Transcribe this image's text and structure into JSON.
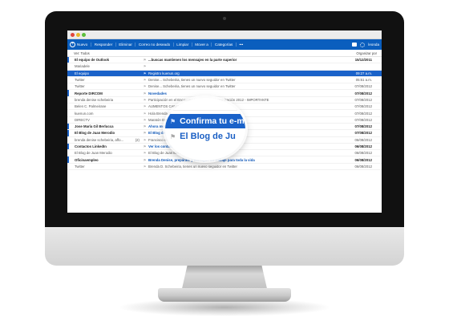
{
  "commandbar": {
    "new_label": "Nuevo",
    "items": [
      "Responder",
      "Eliminar",
      "Correo no deseado",
      "Limpiar",
      "Mover a",
      "Categorías",
      "•••"
    ],
    "user_label": "leonda"
  },
  "filterbar": {
    "view_label": "Ver: Todos",
    "arrange_label": "Organizar por"
  },
  "emails": [
    {
      "from": "El equipo de Outlook",
      "subject": "...buscas mantienen los mensajes en la parte superior",
      "date": "15/12/2011",
      "unread": true,
      "selected": false,
      "subject_link": false
    },
    {
      "from": "Mariadele",
      "subject": "",
      "date": "",
      "unread": false,
      "selected": false,
      "subject_link": false
    },
    {
      "from": "El equipo",
      "subject": "Registro kuenun.org",
      "date": "09:27 a.m.",
      "unread": false,
      "selected": true,
      "subject_link": false
    },
    {
      "from": "Twitter",
      "subject": "Denise... Schebeiria, tienes un nuevo seguidor en Twitter",
      "date": "05:51 a.m.",
      "unread": false,
      "selected": false,
      "subject_link": false
    },
    {
      "from": "Twitter",
      "subject": "Denise... Schebeiria, tienes un nuevo seguidor en Twitter",
      "date": "07/08/2012",
      "unread": false,
      "selected": false,
      "subject_link": false
    },
    {
      "from": "Reporte DIRCOM",
      "subject": "Novedades",
      "date": "07/08/2012",
      "unread": true,
      "selected": false,
      "subject_link": true
    },
    {
      "from": "brenda denise schebeiria",
      "subject": "Participación en el Encuentro Nacional de Comunicación 2012 - IMPORTANTE",
      "date": "07/08/2012",
      "unread": false,
      "selected": false,
      "subject_link": false
    },
    {
      "from": "Belen C. Palmeirane",
      "subject": "AUMENTOS CAMOGA",
      "date": "07/08/2012",
      "unread": false,
      "selected": false,
      "subject_link": false
    },
    {
      "from": "kuenun.com",
      "subject": "Hola Brenda Denise encontramos ofertas laborales para vos",
      "date": "07/08/2012",
      "unread": false,
      "selected": false,
      "subject_link": false
    },
    {
      "from": "DIRECTV",
      "subject": "Maratón DIRECTV 10K - ¡Desafiate a vos mismo!",
      "date": "07/08/2012",
      "unread": false,
      "selected": false,
      "subject_link": false
    },
    {
      "from": "Jose María Gil Berlucca",
      "subject": "Ahora muy mucho mas fach...",
      "date": "07/08/2012",
      "unread": true,
      "selected": false,
      "subject_link": true
    },
    {
      "from": "El Blog de Juan Merodio",
      "subject": "El Blog de Juan Merodio",
      "date": "07/08/2012",
      "unread": true,
      "selected": false,
      "subject_link": true
    },
    {
      "from": "brenda denise schebeiria, affo...",
      "count": "(2)",
      "subject": "Francisco Osvaldo Diaz SA Mar del Plata",
      "date": "06/08/2012",
      "unread": false,
      "selected": false,
      "subject_link": false
    },
    {
      "from": "Contactos LinkedIn",
      "subject": "Ver los contactos, experiencia y más de German...",
      "date": "06/08/2012",
      "unread": true,
      "selected": false,
      "subject_link": true
    },
    {
      "from": "El Blog de Juan Merodio",
      "subject": "El Blog de Juan Merodio",
      "date": "06/08/2012",
      "unread": false,
      "selected": false,
      "subject_link": false
    },
    {
      "from": "Oficinaempleo",
      "subject": "Brenda Denise, prepárate y consigue un trabajo para toda la vida",
      "date": "06/08/2012",
      "unread": true,
      "selected": false,
      "subject_link": true
    },
    {
      "from": "Twitter",
      "subject": "Brenda D. Schebeiria, tienes un nuevo seguidor en Twitter",
      "date": "06/08/2012",
      "unread": false,
      "selected": false,
      "subject_link": false
    }
  ],
  "magnifier": {
    "line1": "Confirma tu e-mail",
    "line2": "El Blog de Ju"
  },
  "colors": {
    "accent": "#0a5ebe",
    "selected_row": "#1a62c9",
    "link": "#0e57b8"
  }
}
